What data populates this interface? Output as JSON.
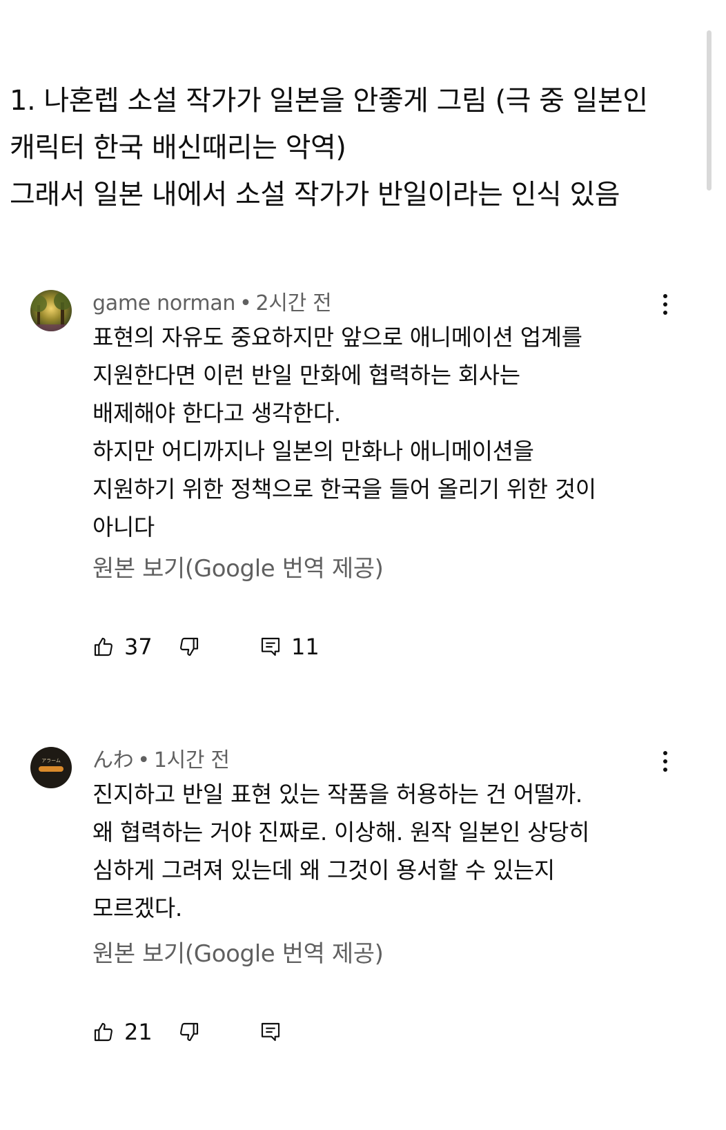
{
  "post_text": {
    "lines": [
      "1. 나혼렙 소설 작가가 일본을 안좋게 그림 (극 중 일본인",
      "캐릭터 한국 배신때리는 악역)",
      "그래서 일본 내에서 소설 작가가 반일이라는 인식 있음"
    ]
  },
  "comments": [
    {
      "author": "game norman",
      "separator": "•",
      "time": "2시간 전",
      "avatar_icon": "forest-avatar",
      "text_lines": [
        "표현의 자유도 중요하지만 앞으로 애니메이션 업계를",
        "지원한다면 이런 반일 만화에 협력하는 회사는",
        "배제해야 한다고 생각한다.",
        "하지만 어디까지나 일본의 만화나 애니메이션을",
        "지원하기 위한 정책으로 한국을 들어 올리기 위한 것이",
        "아니다"
      ],
      "translate_label": "원본 보기(Google 번역 제공)",
      "likes": "37",
      "replies": "11"
    },
    {
      "author": "んわ",
      "separator": "•",
      "time": "1시간 전",
      "avatar_icon": "alarm-logo-avatar",
      "avatar_text": "アラーム",
      "text_lines": [
        "진지하고 반일 표현 있는 작품을 허용하는 건 어떨까.",
        "왜 협력하는 거야 진짜로. 이상해. 원작 일본인 상당히",
        "심하게 그려져 있는데 왜 그것이 용서할 수 있는지",
        "모르겠다."
      ],
      "translate_label": "원본 보기(Google 번역 제공)",
      "likes": "21",
      "replies": ""
    }
  ],
  "icons": {
    "like": "thumbs-up-icon",
    "dislike": "thumbs-down-icon",
    "reply": "comment-icon",
    "menu": "more-vertical-icon"
  },
  "colors": {
    "text": "#0f0f0f",
    "secondary": "#606060",
    "background": "#ffffff"
  }
}
